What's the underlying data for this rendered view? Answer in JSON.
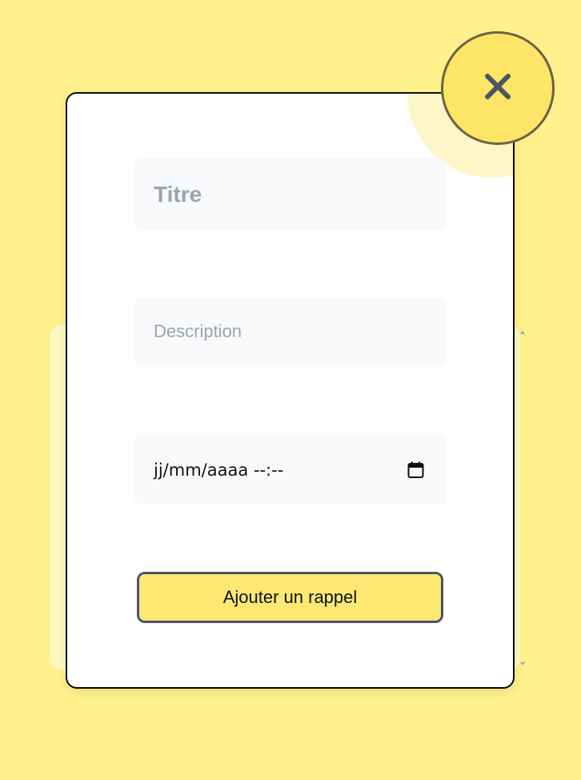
{
  "form": {
    "title_placeholder": "Titre",
    "description_placeholder": "Description",
    "datetime_value": "jj/mm/aaaa --:--",
    "submit_label": "Ajouter un rappel"
  },
  "icons": {
    "close": "close-icon",
    "calendar": "calendar-icon"
  },
  "colors": {
    "background": "#fef08a",
    "accent": "#fde566",
    "input_background": "#f8f9fb",
    "placeholder_text": "#9ca3af"
  }
}
